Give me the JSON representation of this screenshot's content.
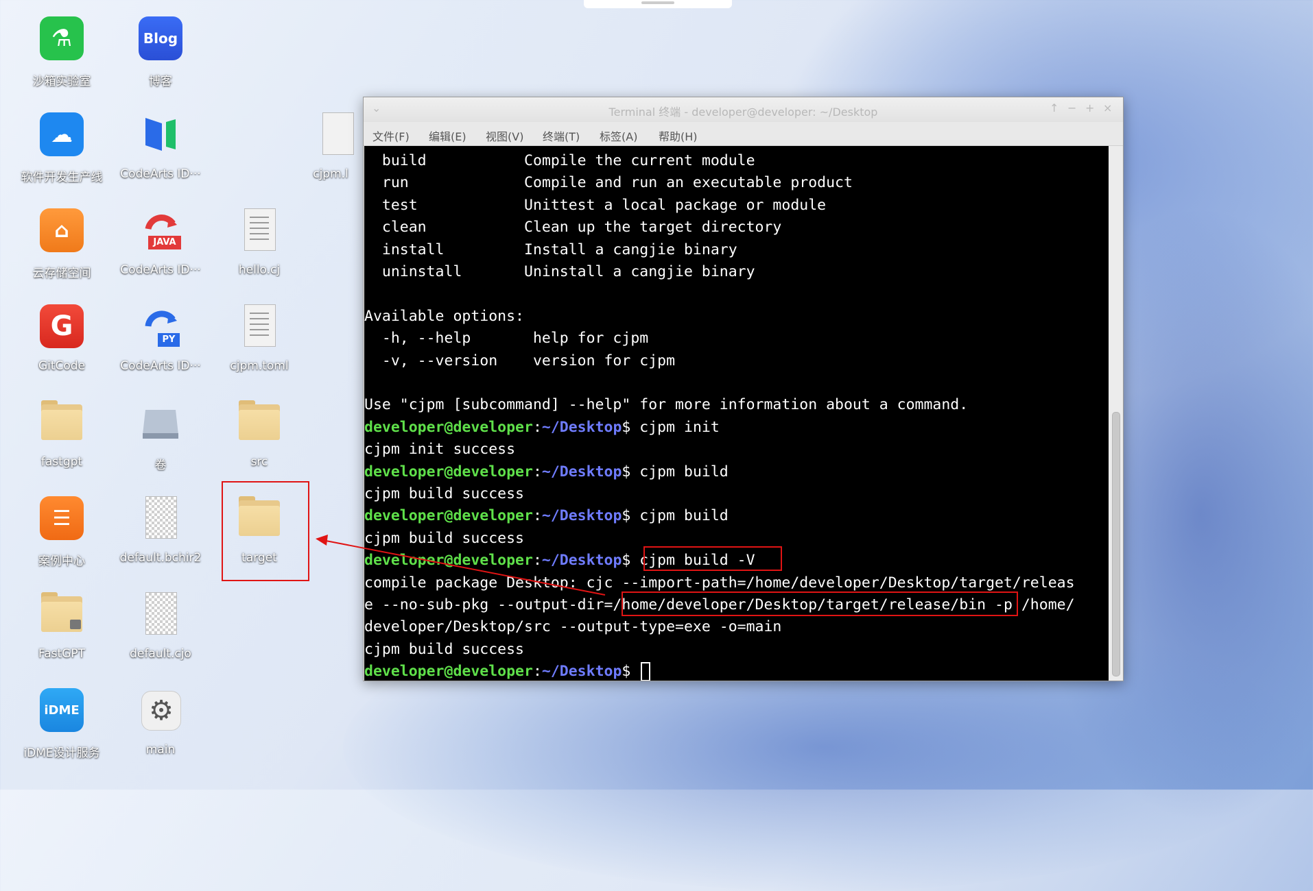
{
  "desktop": {
    "icons": [
      {
        "label": "沙箱实验室",
        "icon": "flask-icon"
      },
      {
        "label": "博客",
        "icon": "blog-icon",
        "badge": "Blog"
      },
      {
        "label": "软件开发生产线",
        "icon": "cloud-devops-icon"
      },
      {
        "label": "CodeArts ID···",
        "icon": "codearts-ide-icon"
      },
      {
        "label": "cjpm.l",
        "icon": "document-icon"
      },
      {
        "label": "云存储空间",
        "icon": "cloud-storage-icon"
      },
      {
        "label": "CodeArts ID···",
        "icon": "codearts-java-icon",
        "badge": "JAVA"
      },
      {
        "label": "hello.cj",
        "icon": "document-icon"
      },
      {
        "label": "GitCode",
        "icon": "gitcode-icon",
        "badge": "G"
      },
      {
        "label": "CodeArts ID···",
        "icon": "codearts-python-icon",
        "badge": "PY"
      },
      {
        "label": "cjpm.toml",
        "icon": "document-icon"
      },
      {
        "label": "fastgpt",
        "icon": "folder-icon"
      },
      {
        "label": "卷",
        "icon": "drive-icon"
      },
      {
        "label": "src",
        "icon": "folder-icon"
      },
      {
        "label": "案例中心",
        "icon": "case-center-icon"
      },
      {
        "label": "default.bchir2",
        "icon": "binary-file-icon"
      },
      {
        "label": "target",
        "icon": "folder-icon"
      },
      {
        "label": "FastGPT",
        "icon": "locked-folder-icon"
      },
      {
        "label": "default.cjo",
        "icon": "binary-file-icon"
      },
      {
        "label": "iDME设计服务",
        "icon": "idme-icon",
        "badge": "iDME"
      },
      {
        "label": "main",
        "icon": "gear-icon"
      }
    ]
  },
  "terminal": {
    "title": "Terminal 终端 - developer@developer: ~/Desktop",
    "menus": [
      "文件(F)",
      "编辑(E)",
      "视图(V)",
      "终端(T)",
      "标签(A)",
      "帮助(H)"
    ],
    "prompt_user": "developer@developer",
    "prompt_path": "~/Desktop",
    "lines": [
      "  build           Compile the current module",
      "  run             Compile and run an executable product",
      "  test            Unittest a local package or module",
      "  clean           Clean up the target directory",
      "  install         Install a cangjie binary",
      "  uninstall       Uninstall a cangjie binary",
      "",
      "Available options:",
      "  -h, --help       help for cjpm",
      "  -v, --version    version for cjpm",
      "",
      "Use \"cjpm [subcommand] --help\" for more information about a command.",
      "",
      "cjpm init success",
      "",
      "cjpm build success",
      "",
      "cjpm build success",
      "",
      "compile package Desktop: cjc --import-path=/home/developer/Desktop/target/releas",
      "e --no-sub-pkg --output-dir=/home/developer/Desktop/target/release/bin -p /home/",
      "developer/Desktop/src --output-type=exe -o=main",
      "cjpm build success",
      ""
    ],
    "commands": {
      "c12": "cjpm init",
      "c14": "cjpm build",
      "c16": "cjpm build",
      "c18": "cjpm build -V",
      "c23": ""
    },
    "window_controls": [
      "↑",
      "−",
      "+",
      "×"
    ]
  }
}
